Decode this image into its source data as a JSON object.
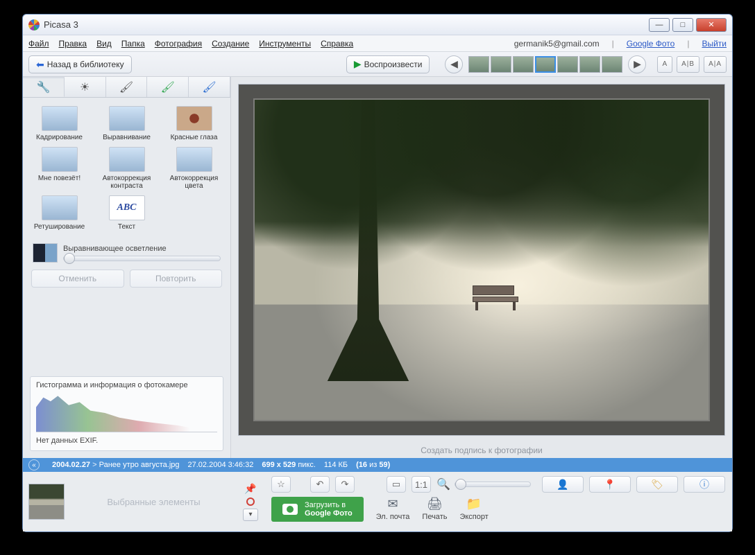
{
  "window": {
    "title": "Picasa 3"
  },
  "menu": {
    "items": [
      "Файл",
      "Правка",
      "Вид",
      "Папка",
      "Фотография",
      "Создание",
      "Инструменты",
      "Справка"
    ],
    "account": "germanik5@gmail.com",
    "google_photos": "Google Фото",
    "logout": "Выйти"
  },
  "toolbar": {
    "back": "Назад в библиотеку",
    "play": "Воспроизвести",
    "compare_buttons": [
      "A",
      "A|B",
      "A|A"
    ]
  },
  "sidebar": {
    "tools": [
      {
        "label": "Кадрирование"
      },
      {
        "label": "Выравнивание"
      },
      {
        "label": "Красные глаза"
      },
      {
        "label": "Мне повезёт!"
      },
      {
        "label": "Автокоррекция контраста"
      },
      {
        "label": "Автокоррекция цвета"
      },
      {
        "label": "Ретуширование"
      },
      {
        "label": "Текст"
      }
    ],
    "slider_label": "Выравнивающее осветление",
    "undo": "Отменить",
    "redo": "Повторить",
    "histogram_title": "Гистограмма и информация о фотокамере",
    "exif_msg": "Нет данных EXIF."
  },
  "viewer": {
    "caption_placeholder": "Создать подпись к фотографии"
  },
  "infobar": {
    "folder": "2004.02.27",
    "filename": "Ранее утро августа.jpg",
    "datetime": "27.02.2004 3:46:32",
    "dimensions": "699 x 529",
    "dim_suffix": "пикс.",
    "filesize": "114 КБ",
    "position_open": "(16",
    "position_of": " из ",
    "position_total": "59)"
  },
  "tray": {
    "selected_label": "Выбранные элементы"
  },
  "actions": {
    "upload_line1": "Загрузить в",
    "upload_line2": "Google Фото",
    "email": "Эл. почта",
    "print": "Печать",
    "export": "Экспорт"
  }
}
